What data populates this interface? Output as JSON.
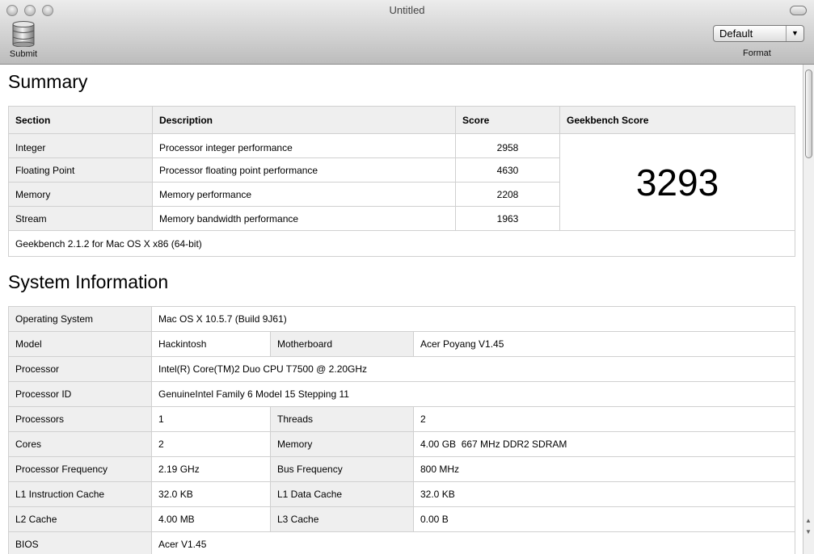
{
  "window": {
    "title": "Untitled"
  },
  "toolbar": {
    "submit_label": "Submit",
    "format_value": "Default",
    "format_label": "Format"
  },
  "summary": {
    "heading": "Summary",
    "headers": {
      "section": "Section",
      "description": "Description",
      "score": "Score",
      "geekbench_score": "Geekbench Score"
    },
    "rows": [
      {
        "section": "Integer",
        "description": "Processor integer performance",
        "score": "2958"
      },
      {
        "section": "Floating Point",
        "description": "Processor floating point performance",
        "score": "4630"
      },
      {
        "section": "Memory",
        "description": "Memory performance",
        "score": "2208"
      },
      {
        "section": "Stream",
        "description": "Memory bandwidth performance",
        "score": "1963"
      }
    ],
    "total": "3293",
    "footer": "Geekbench 2.1.2 for Mac OS X x86 (64-bit)"
  },
  "system": {
    "heading": "System Information",
    "os_label": "Operating System",
    "os_value": "Mac OS X 10.5.7 (Build 9J61)",
    "model_label": "Model",
    "model_value": "Hackintosh",
    "motherboard_label": "Motherboard",
    "motherboard_value": "Acer Poyang V1.45",
    "processor_label": "Processor",
    "processor_value": "Intel(R) Core(TM)2 Duo CPU T7500 @ 2.20GHz",
    "processor_id_label": "Processor ID",
    "processor_id_value": "GenuineIntel Family 6 Model 15 Stepping 11",
    "processors_label": "Processors",
    "processors_value": "1",
    "threads_label": "Threads",
    "threads_value": "2",
    "cores_label": "Cores",
    "cores_value": "2",
    "memory_label": "Memory",
    "memory_value": "4.00 GB  667 MHz DDR2 SDRAM",
    "freq_label": "Processor Frequency",
    "freq_value": "2.19 GHz",
    "bus_label": "Bus Frequency",
    "bus_value": "800 MHz",
    "l1i_label": "L1 Instruction Cache",
    "l1i_value": "32.0 KB",
    "l1d_label": "L1 Data Cache",
    "l1d_value": "32.0 KB",
    "l2_label": "L2 Cache",
    "l2_value": "4.00 MB",
    "l3_label": "L3 Cache",
    "l3_value": "0.00 B",
    "bios_label": "BIOS",
    "bios_value": "Acer V1.45"
  }
}
